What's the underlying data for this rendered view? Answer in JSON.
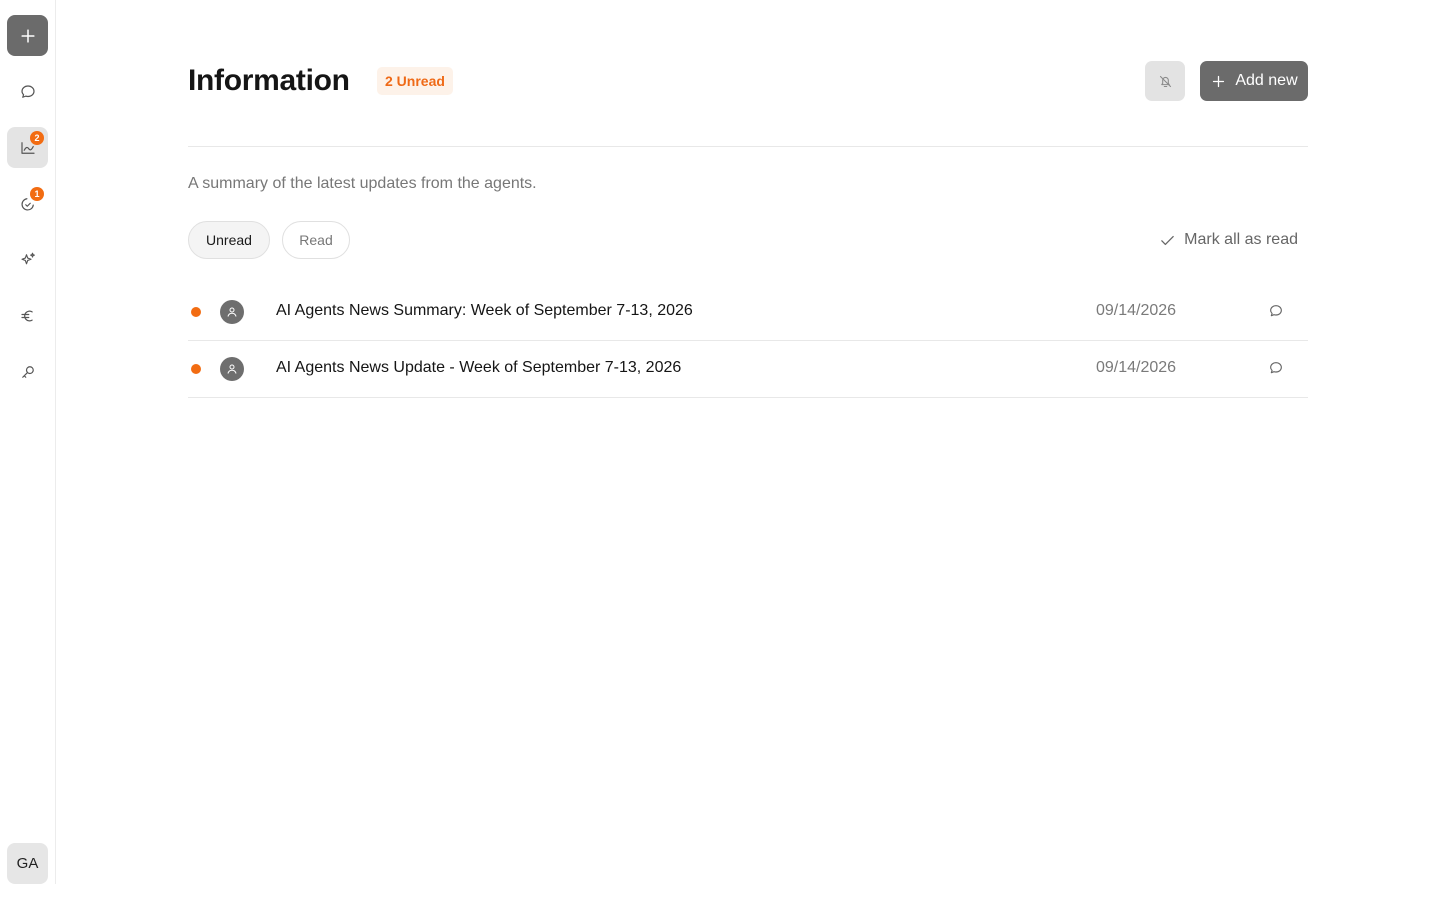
{
  "sidebar": {
    "new_badge": "",
    "items": [
      {
        "icon": "chat-bubble-icon",
        "badge": ""
      },
      {
        "icon": "chart-line-icon",
        "badge": "2"
      },
      {
        "icon": "moon-check-icon",
        "badge": "1"
      },
      {
        "icon": "sparkles-icon",
        "badge": ""
      },
      {
        "icon": "euro-icon",
        "badge": ""
      },
      {
        "icon": "key-icon",
        "badge": ""
      }
    ],
    "user_initials": "GA"
  },
  "header": {
    "title": "Information",
    "unread_badge": "2 Unread",
    "add_label": "Add new"
  },
  "subtitle": "A summary of the latest updates from the agents.",
  "tabs": {
    "unread": "Unread",
    "read": "Read"
  },
  "mark_all": "Mark all as read",
  "notifications": [
    {
      "title": "AI Agents News Summary: Week of September 7-13, 2026",
      "date": "09/14/2026"
    },
    {
      "title": "AI Agents News Update - Week of September 7-13, 2026",
      "date": "09/14/2026"
    }
  ],
  "colors": {
    "accent": "#f26c12",
    "button_dark": "#6b6b6b"
  }
}
